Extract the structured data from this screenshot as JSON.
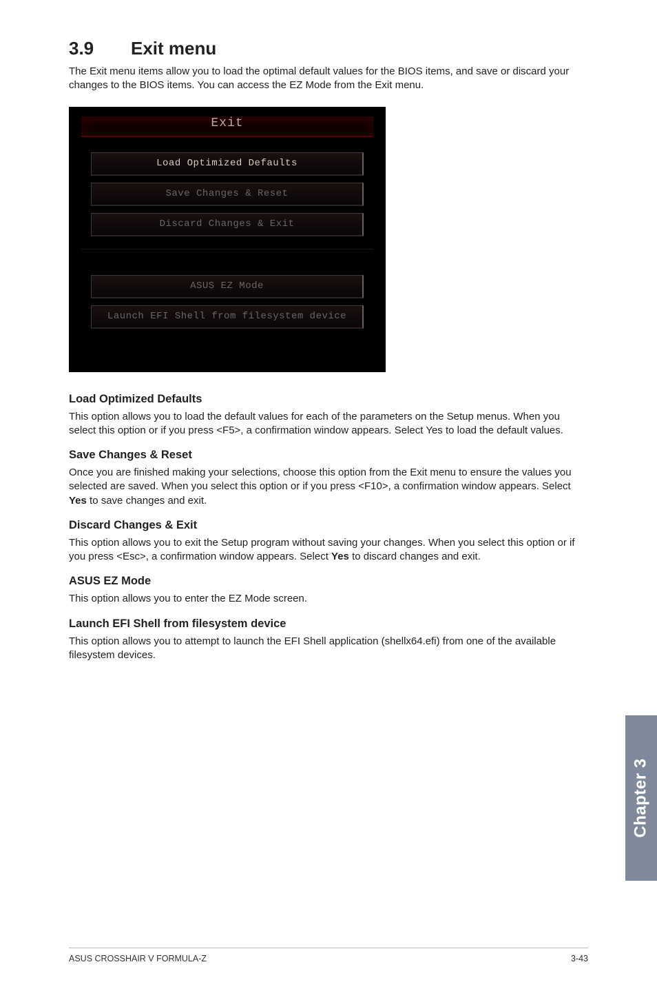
{
  "section": {
    "number": "3.9",
    "title": "Exit menu"
  },
  "intro": "The Exit menu items allow you to load the optimal default values for the BIOS items, and save or discard your changes to the BIOS items. You can access the EZ Mode from the Exit menu.",
  "bios": {
    "title": "Exit",
    "btn1": "Load Optimized Defaults",
    "btn2": "Save Changes & Reset",
    "btn3": "Discard Changes & Exit",
    "btn4": "ASUS EZ Mode",
    "btn5": "Launch EFI Shell from filesystem device"
  },
  "subs": {
    "s1h": "Load Optimized Defaults",
    "s1p": "This option allows you to load the default values for each of the parameters on the Setup menus. When you select this option or if you press <F5>, a confirmation window appears. Select Yes to load the default values.",
    "s2h": "Save Changes & Reset",
    "s2p_a": "Once you are finished making your selections, choose this option from the Exit menu to ensure the values you selected are saved. When you select this option or if you press <F10>, a confirmation window appears. Select ",
    "s2p_b": "Yes",
    "s2p_c": " to save changes and exit.",
    "s3h": "Discard Changes & Exit",
    "s3p_a": "This option allows you to exit the Setup program without saving your changes. When you select this option or if you press <Esc>, a confirmation window appears. Select ",
    "s3p_b": "Yes",
    "s3p_c": " to discard changes and exit.",
    "s4h": "ASUS EZ Mode",
    "s4p": "This option allows you to enter the EZ Mode screen.",
    "s5h": "Launch EFI Shell from filesystem device",
    "s5p": "This option allows you to attempt to launch the EFI Shell application (shellx64.efi) from one of the available filesystem devices."
  },
  "footer": {
    "left": "ASUS CROSSHAIR V FORMULA-Z",
    "right": "3-43"
  },
  "sidetab": "Chapter 3"
}
